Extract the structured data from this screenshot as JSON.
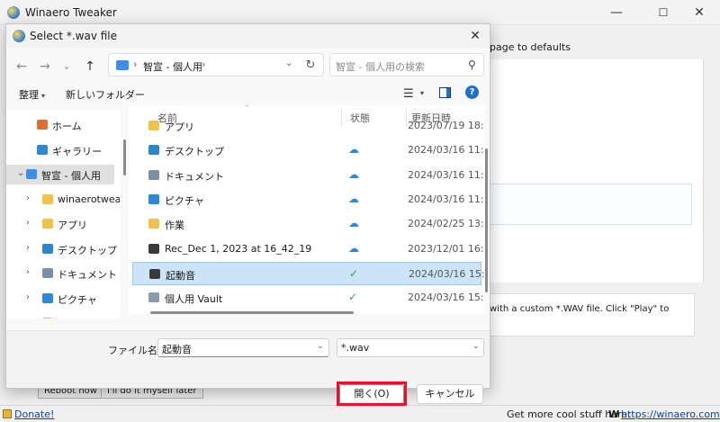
{
  "main_window": {
    "title": "Winaero Tweaker",
    "minimize_label": "—",
    "maximize_label": "☐",
    "close_label": "✕",
    "reset_text": "page to defaults",
    "description": "with a custom *.WAV file. Click \"Play\" to",
    "buttons": {
      "reboot_now": "Reboot now",
      "do_it_myself": "I'll do it myself later"
    },
    "status": {
      "donate": "Donate!",
      "more_stuff": "Get more cool stuff here:",
      "logo": "W",
      "link": "https://winaero.com"
    }
  },
  "dialog": {
    "title": "Select *.wav file",
    "close_label": "✕",
    "nav": {
      "back": "←",
      "forward": "→",
      "dropdown": "⌄",
      "up": "↑",
      "refresh": "↻"
    },
    "address": {
      "separator": "›",
      "path": "智宣 - 個人用",
      "trailing": "›",
      "dropdown": "⌄"
    },
    "search_placeholder": "智宣 - 個人用の検索",
    "search_icon": "⚲",
    "commands": {
      "organize": "整理",
      "new_folder": "新しいフォルダー",
      "caret": "▾",
      "view_icon": "☰",
      "help": "?"
    },
    "nav_pane": [
      {
        "label": "ホーム",
        "icon": "home-icon",
        "color": "#e46c2c",
        "indent": 1,
        "chevron": ""
      },
      {
        "label": "ギャラリー",
        "icon": "gallery-icon",
        "color": "#2f87d8",
        "indent": 1,
        "chevron": ""
      },
      {
        "label": "智宣 - 個人用",
        "icon": "cloud-folder-icon",
        "color": "#3d8ee8",
        "indent": 0,
        "chevron": "⌄",
        "selected": true
      },
      {
        "label": "winaerotweaker",
        "icon": "folder-icon",
        "color": "#f0c24a",
        "indent": 2,
        "chevron": "›"
      },
      {
        "label": "アプリ",
        "icon": "folder-icon",
        "color": "#f0c24a",
        "indent": 2,
        "chevron": "›"
      },
      {
        "label": "デスクトップ",
        "icon": "desktop-folder-icon",
        "color": "#2a86d1",
        "indent": 2,
        "chevron": "›"
      },
      {
        "label": "ドキュメント",
        "icon": "documents-folder-icon",
        "color": "#7c8fa8",
        "indent": 2,
        "chevron": "›"
      },
      {
        "label": "ピクチャ",
        "icon": "pictures-folder-icon",
        "color": "#2f87d8",
        "indent": 2,
        "chevron": "›"
      },
      {
        "label": "作業",
        "icon": "folder-icon",
        "color": "#f0c24a",
        "indent": 2,
        "chevron": "›"
      }
    ],
    "columns": {
      "name": "名前",
      "status": "状態",
      "modified": "更新日時",
      "sort": "⌃"
    },
    "files": [
      {
        "name": "アプリ",
        "status": "",
        "date": "2023/07/19 18:30",
        "color": "#f0c24a",
        "status_color": "#2f87d8"
      },
      {
        "name": "デスクトップ",
        "status": "☁",
        "date": "2024/03/16 11:19",
        "color": "#2a86d1",
        "status_color": "#2f87d8"
      },
      {
        "name": "ドキュメント",
        "status": "☁",
        "date": "2024/03/16 11:19",
        "color": "#7c8fa8",
        "status_color": "#2f87d8"
      },
      {
        "name": "ピクチャ",
        "status": "☁",
        "date": "2024/03/16 11:19",
        "color": "#2f87d8",
        "status_color": "#2f87d8"
      },
      {
        "name": "作業",
        "status": "☁",
        "date": "2024/02/25 13:38",
        "color": "#f0c24a",
        "status_color": "#2f87d8"
      },
      {
        "name": "Rec_Dec 1, 2023 at 16_42_19",
        "status": "☁",
        "date": "2023/12/01 16:48",
        "color": "#3a3a3a",
        "status_color": "#2f87d8"
      },
      {
        "name": "起動音",
        "status": "✓",
        "date": "2024/03/16 15:04",
        "color": "#3a3a3a",
        "status_color": "#2e9e55",
        "selected": true
      },
      {
        "name": "個人用 Vault",
        "status": "✓",
        "date": "2024/03/16 15:11",
        "color": "#8a9bb0",
        "status_color": "#2e9e55"
      }
    ],
    "filename": {
      "label": "ファイル名(N):",
      "value": "起動音",
      "dropdown": "⌄"
    },
    "filetype": {
      "value": "*.wav",
      "dropdown": "⌄"
    },
    "open_label": "開く(O)",
    "cancel_label": "キャンセル",
    "highlight_color": "#e8112d"
  }
}
